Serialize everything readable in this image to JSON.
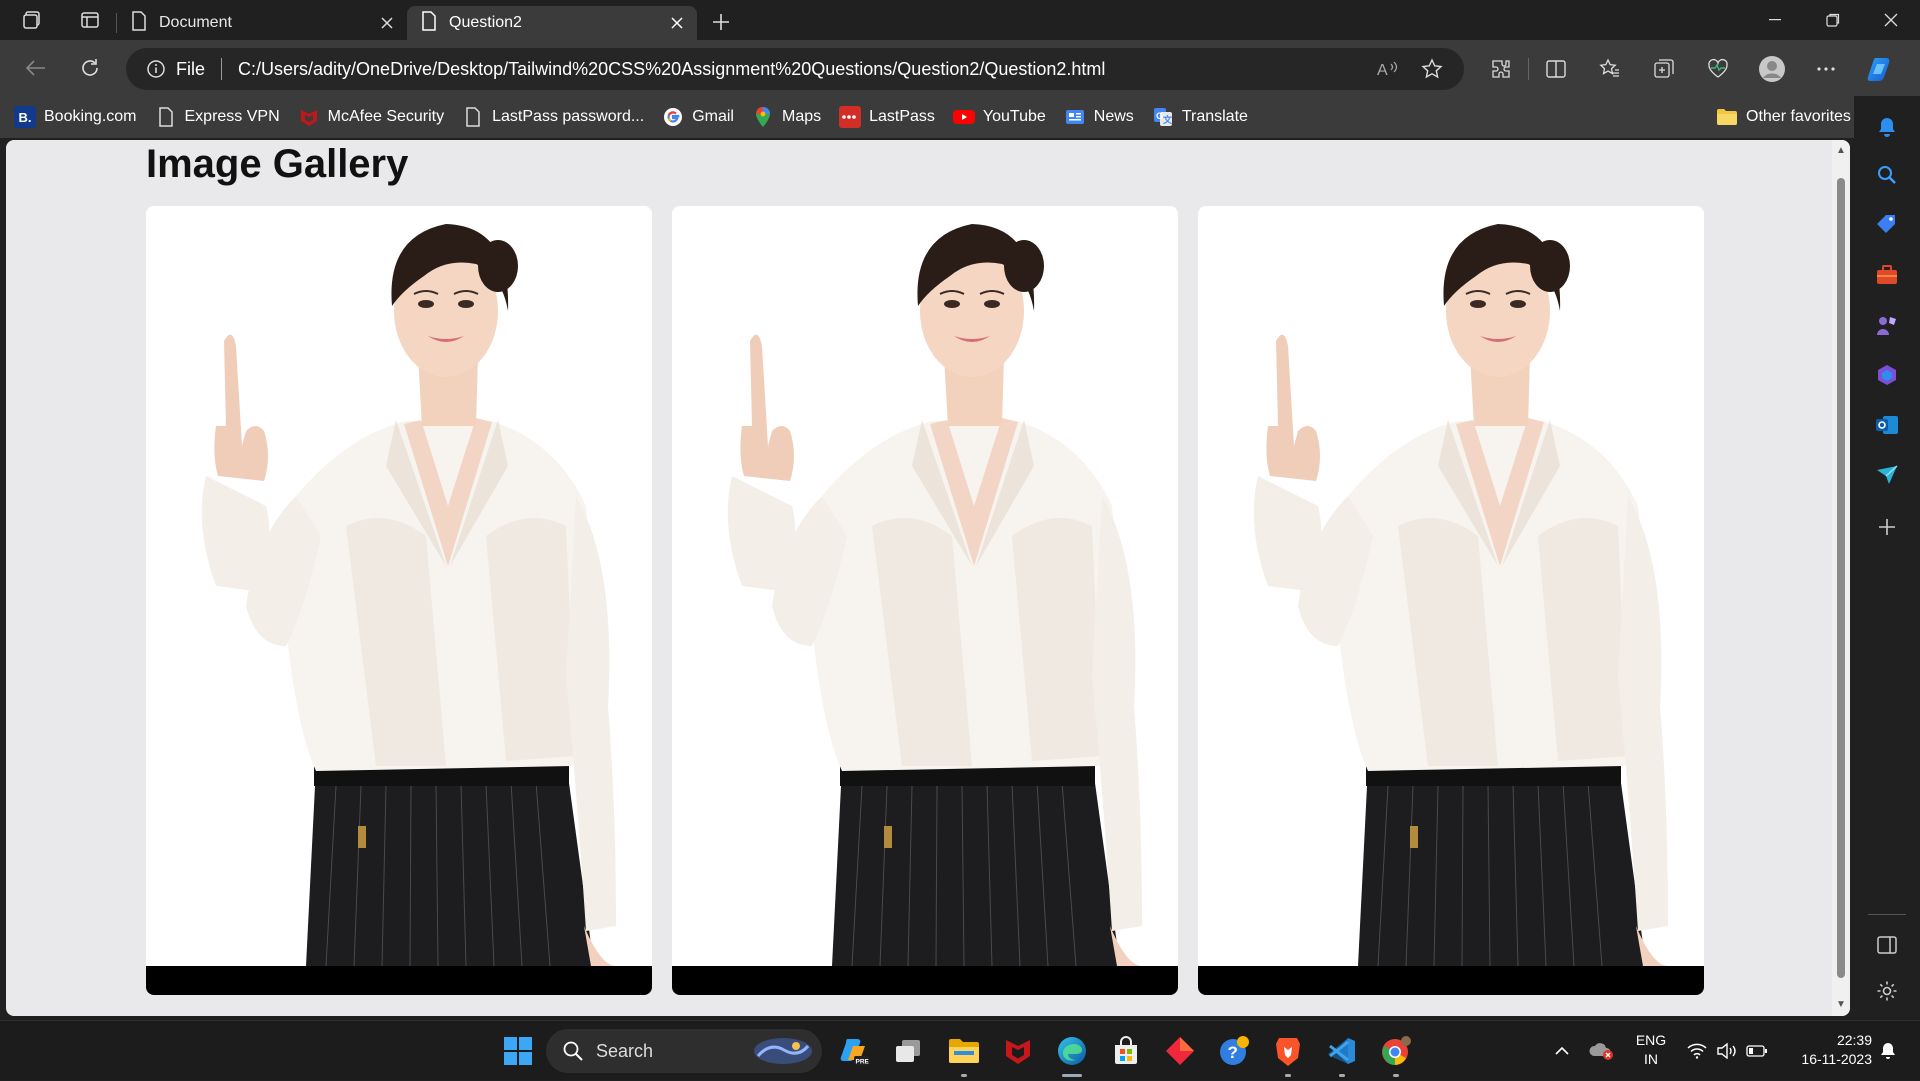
{
  "tabs": [
    {
      "title": "Document",
      "active": false
    },
    {
      "title": "Question2",
      "active": true
    }
  ],
  "address": {
    "scheme_label": "File",
    "url": "C:/Users/adity/OneDrive/Desktop/Tailwind%20CSS%20Assignment%20Questions/Question2/Question2.html"
  },
  "favorites": [
    {
      "label": "Booking.com",
      "icon": "booking-icon"
    },
    {
      "label": "Express VPN",
      "icon": "page-icon"
    },
    {
      "label": "McAfee Security",
      "icon": "mcafee-icon"
    },
    {
      "label": "LastPass password...",
      "icon": "page-icon"
    },
    {
      "label": "Gmail",
      "icon": "google-icon"
    },
    {
      "label": "Maps",
      "icon": "maps-icon"
    },
    {
      "label": "LastPass",
      "icon": "lastpass-icon"
    },
    {
      "label": "YouTube",
      "icon": "youtube-icon"
    },
    {
      "label": "News",
      "icon": "news-icon"
    },
    {
      "label": "Translate",
      "icon": "translate-icon"
    }
  ],
  "favorites_other": "Other favorites",
  "page": {
    "heading": "Image Gallery",
    "cards": [
      {
        "image": "woman-pointing-up-photo"
      },
      {
        "image": "woman-pointing-up-photo"
      },
      {
        "image": "woman-pointing-up-photo"
      }
    ]
  },
  "taskbar": {
    "search_placeholder": "Search",
    "language_top": "ENG",
    "language_bottom": "IN",
    "time": "22:39",
    "date": "16-11-2023"
  },
  "colors": {
    "browser_chrome": "#3b3b3b",
    "titlebar": "#202020",
    "page_background": "#e9e9eb",
    "card_bar": "#000000",
    "taskbar": "#1c1c1c"
  }
}
